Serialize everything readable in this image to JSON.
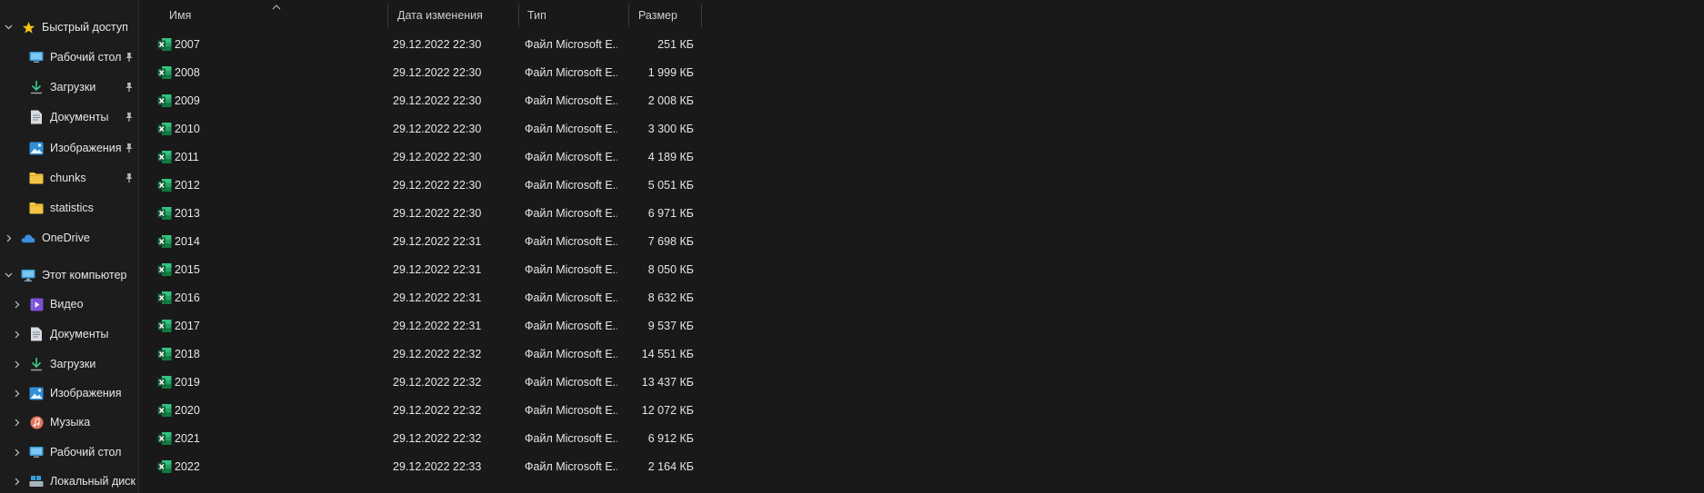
{
  "sidebar": {
    "quick_access": "Быстрый доступ",
    "quick_items": [
      {
        "label": "Рабочий стол",
        "icon": "desktop-icon",
        "pinned": true
      },
      {
        "label": "Загрузки",
        "icon": "download-icon",
        "pinned": true
      },
      {
        "label": "Документы",
        "icon": "documents-icon",
        "pinned": true
      },
      {
        "label": "Изображения",
        "icon": "pictures-icon",
        "pinned": true
      },
      {
        "label": "chunks",
        "icon": "folder-icon",
        "pinned": true
      },
      {
        "label": "statistics",
        "icon": "folder-icon",
        "pinned": false
      }
    ],
    "onedrive": "OneDrive",
    "this_pc": "Этот компьютер",
    "pc_items": [
      {
        "label": "Видео",
        "icon": "video-icon"
      },
      {
        "label": "Документы",
        "icon": "documents-icon"
      },
      {
        "label": "Загрузки",
        "icon": "download-icon"
      },
      {
        "label": "Изображения",
        "icon": "pictures-icon"
      },
      {
        "label": "Музыка",
        "icon": "music-icon"
      },
      {
        "label": "Рабочий стол",
        "icon": "desktop-icon"
      },
      {
        "label": "Локальный диск (",
        "icon": "drive-icon"
      }
    ]
  },
  "columns": {
    "name": "Имя",
    "date": "Дата изменения",
    "type": "Тип",
    "size": "Размер"
  },
  "files": [
    {
      "name": "2007",
      "date": "29.12.2022 22:30",
      "type": "Файл Microsoft E...",
      "size": "251 КБ"
    },
    {
      "name": "2008",
      "date": "29.12.2022 22:30",
      "type": "Файл Microsoft E...",
      "size": "1 999 КБ"
    },
    {
      "name": "2009",
      "date": "29.12.2022 22:30",
      "type": "Файл Microsoft E...",
      "size": "2 008 КБ"
    },
    {
      "name": "2010",
      "date": "29.12.2022 22:30",
      "type": "Файл Microsoft E...",
      "size": "3 300 КБ"
    },
    {
      "name": "2011",
      "date": "29.12.2022 22:30",
      "type": "Файл Microsoft E...",
      "size": "4 189 КБ"
    },
    {
      "name": "2012",
      "date": "29.12.2022 22:30",
      "type": "Файл Microsoft E...",
      "size": "5 051 КБ"
    },
    {
      "name": "2013",
      "date": "29.12.2022 22:30",
      "type": "Файл Microsoft E...",
      "size": "6 971 КБ"
    },
    {
      "name": "2014",
      "date": "29.12.2022 22:31",
      "type": "Файл Microsoft E...",
      "size": "7 698 КБ"
    },
    {
      "name": "2015",
      "date": "29.12.2022 22:31",
      "type": "Файл Microsoft E...",
      "size": "8 050 КБ"
    },
    {
      "name": "2016",
      "date": "29.12.2022 22:31",
      "type": "Файл Microsoft E...",
      "size": "8 632 КБ"
    },
    {
      "name": "2017",
      "date": "29.12.2022 22:31",
      "type": "Файл Microsoft E...",
      "size": "9 537 КБ"
    },
    {
      "name": "2018",
      "date": "29.12.2022 22:32",
      "type": "Файл Microsoft E...",
      "size": "14 551 КБ"
    },
    {
      "name": "2019",
      "date": "29.12.2022 22:32",
      "type": "Файл Microsoft E...",
      "size": "13 437 КБ"
    },
    {
      "name": "2020",
      "date": "29.12.2022 22:32",
      "type": "Файл Microsoft E...",
      "size": "12 072 КБ"
    },
    {
      "name": "2021",
      "date": "29.12.2022 22:32",
      "type": "Файл Microsoft E...",
      "size": "6 912 КБ"
    },
    {
      "name": "2022",
      "date": "29.12.2022 22:33",
      "type": "Файл Microsoft E...",
      "size": "2 164 КБ"
    }
  ],
  "colors": {
    "background": "#191919",
    "text": "#e6e6e6",
    "excel_green": "#1d6f42",
    "folder_yellow": "#f3c443",
    "star_yellow": "#f5c518",
    "onedrive_blue": "#3a8fde"
  }
}
